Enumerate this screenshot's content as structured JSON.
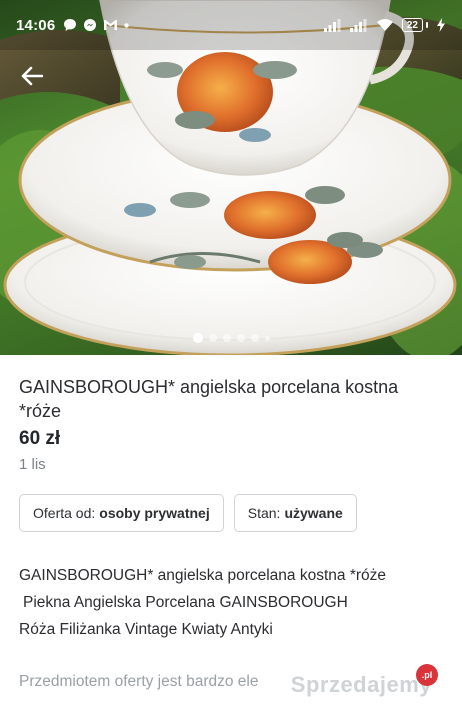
{
  "status_bar": {
    "time": "14:06",
    "battery_level": "22",
    "icons_left": [
      "chat-bubble-icon",
      "messenger-icon",
      "gmail-icon",
      "dot-icon"
    ],
    "icons_right": [
      "signal-icon",
      "signal-icon",
      "wifi-icon",
      "battery-icon",
      "charging-icon"
    ]
  },
  "gallery": {
    "image_count": 6,
    "active_index": 0
  },
  "listing": {
    "title": "GAINSBOROUGH* angielska porcelana kostna *róże",
    "price": "60 zł",
    "date": "1 lis",
    "chips": [
      {
        "label": "Oferta od:",
        "value": "osoby prywatnej"
      },
      {
        "label": "Stan:",
        "value": "używane"
      }
    ],
    "description": [
      "GAINSBOROUGH* angielska porcelana kostna *róże",
      "Piekna Angielska Porcelana GAINSBOROUGH",
      "Róża Filiżanka Vintage Kwiaty Antyki"
    ],
    "description_faded": "Przedmiotem oferty jest bardzo ele"
  },
  "watermark": {
    "text": "Sprzedajemy",
    "badge": ".pl"
  },
  "colors": {
    "accent_red": "#d9343a",
    "text_dark": "#2c2d30",
    "text_muted": "#7c8287",
    "chip_border": "#cfd3d7"
  }
}
